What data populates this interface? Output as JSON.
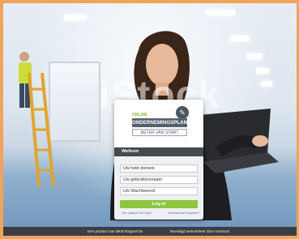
{
  "watermark": "iStock",
  "footer": {
    "left": "Een product van MKB Rapport bv",
    "right": "Beveiligd webverkeer door Geotrust"
  },
  "brand": {
    "online": "ONLINE",
    "title": "ONDERNEMINGSPLAN",
    "subtitle": "BETER VAN START",
    "icon": "document-pencil-icon"
  },
  "login": {
    "welcome": "Welkom",
    "fields": [
      {
        "placeholder": "Uw hebt domein"
      },
      {
        "placeholder": "Uw gebruikersnaam"
      },
      {
        "placeholder": "Uw Wachtwoord"
      }
    ],
    "button": "Log in",
    "links": [
      "Hoe wijzig ik het logo?",
      "Wachtwoord vergeten?"
    ]
  },
  "colors": {
    "accent_green": "#8cc63f",
    "bar_dark": "#454a50",
    "frame_orange": "#f0a35a"
  }
}
